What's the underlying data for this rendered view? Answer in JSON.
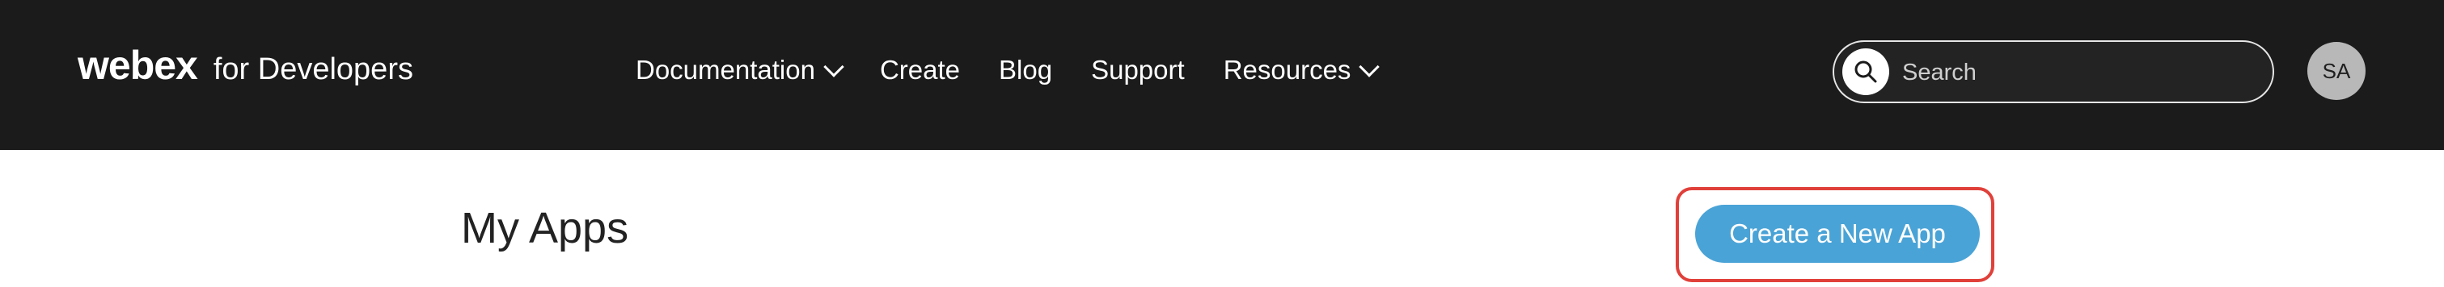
{
  "brand": {
    "logo": "webex",
    "subtitle": "for Developers"
  },
  "nav": {
    "items": [
      {
        "label": "Documentation",
        "has_dropdown": true
      },
      {
        "label": "Create",
        "has_dropdown": false
      },
      {
        "label": "Blog",
        "has_dropdown": false
      },
      {
        "label": "Support",
        "has_dropdown": false
      },
      {
        "label": "Resources",
        "has_dropdown": true
      }
    ]
  },
  "search": {
    "placeholder": "Search",
    "icon": "search-icon"
  },
  "user": {
    "initials": "SA"
  },
  "main": {
    "title": "My Apps",
    "create_button_label": "Create a New App"
  },
  "colors": {
    "header_bg": "#1b1b1b",
    "accent_button": "#4aa3d6",
    "highlight_outline": "#e0403a",
    "avatar_bg": "#b8b8b8"
  }
}
